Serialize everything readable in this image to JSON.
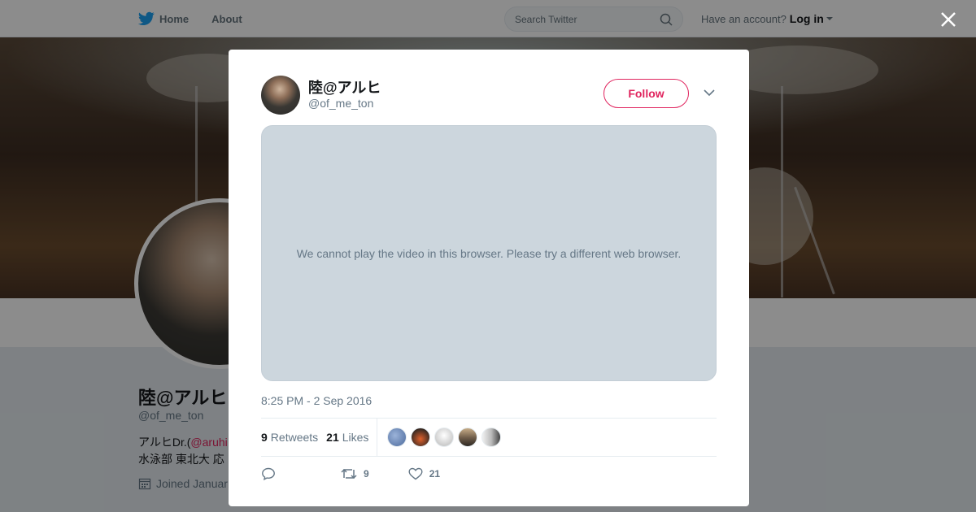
{
  "nav": {
    "home_label": "Home",
    "about_label": "About",
    "search_placeholder": "Search Twitter",
    "account_prompt": "Have an account?",
    "login_label": "Log in"
  },
  "profile": {
    "name": "陸@アルヒ",
    "handle": "@of_me_ton",
    "bio_line1_prefix": "アルヒDr.(",
    "bio_line1_link": "@aruhi",
    "bio_line2": "水泳部 東北大 応",
    "joined": "Joined Januar"
  },
  "tweet": {
    "author_name": "陸@アルヒ",
    "author_handle": "@of_me_ton",
    "follow_label": "Follow",
    "video_message": "We cannot play the video in this browser. Please try a different web browser.",
    "timestamp": "8:25 PM - 2 Sep 2016",
    "retweets_count": "9",
    "retweets_label": "Retweets",
    "likes_count": "21",
    "likes_label": "Likes",
    "reply_count": "",
    "retweet_action_count": "9",
    "like_action_count": "21"
  },
  "colors": {
    "brand": "#1da1f2",
    "accent": "#e0245e",
    "muted": "#657786"
  }
}
